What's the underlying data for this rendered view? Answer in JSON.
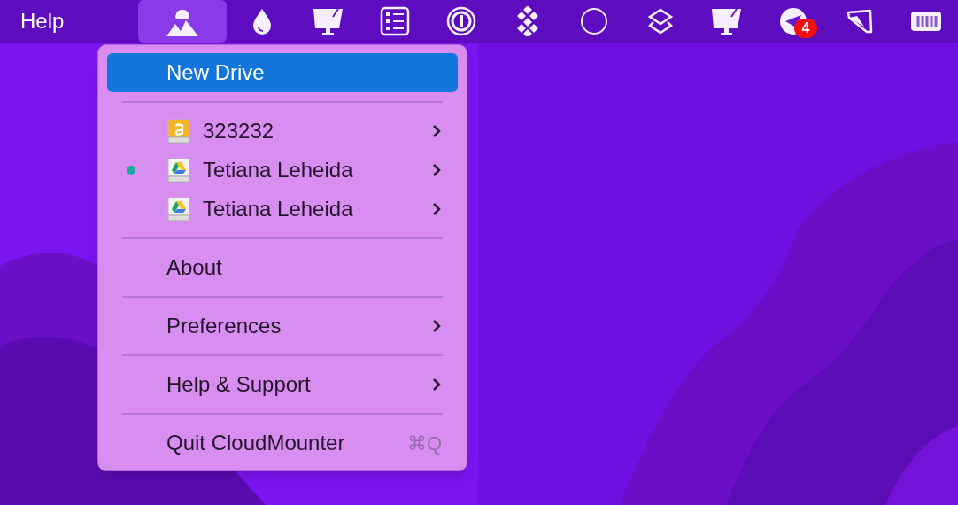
{
  "menu_bar": {
    "app_menu": "Help",
    "status_icons": [
      {
        "kind": "mountains",
        "selected": true
      },
      {
        "kind": "drop",
        "selected": false
      },
      {
        "kind": "monitor",
        "selected": false
      },
      {
        "kind": "list",
        "selected": false
      },
      {
        "kind": "ring",
        "selected": false
      },
      {
        "kind": "diamonds",
        "selected": false
      },
      {
        "kind": "circle",
        "selected": false
      },
      {
        "kind": "layers",
        "selected": false
      },
      {
        "kind": "monitor",
        "selected": false
      },
      {
        "kind": "plane",
        "selected": false,
        "badge": "4"
      },
      {
        "kind": "tag",
        "selected": false
      },
      {
        "kind": "battery",
        "selected": false
      }
    ]
  },
  "menu": {
    "items": [
      {
        "kind": "action",
        "label": "New Drive",
        "selected": true
      },
      {
        "kind": "separator"
      },
      {
        "kind": "drive",
        "label": "323232",
        "icon": {
          "kind": "amazon"
        },
        "connected": false,
        "submenu": true
      },
      {
        "kind": "drive",
        "label": "Tetiana Leheida",
        "icon": {
          "kind": "gdrive"
        },
        "connected": true,
        "submenu": true
      },
      {
        "kind": "drive",
        "label": "Tetiana Leheida",
        "icon": {
          "kind": "gdrive"
        },
        "connected": false,
        "submenu": true
      },
      {
        "kind": "separator"
      },
      {
        "kind": "action",
        "label": "About",
        "selected": false
      },
      {
        "kind": "separator"
      },
      {
        "kind": "action",
        "label": "Preferences",
        "selected": false,
        "submenu": true
      },
      {
        "kind": "separator"
      },
      {
        "kind": "action",
        "label": "Help & Support",
        "selected": false,
        "submenu": true
      },
      {
        "kind": "separator"
      },
      {
        "kind": "action",
        "label": "Quit CloudMounter",
        "selected": false,
        "shortcut": "⌘Q"
      }
    ]
  }
}
